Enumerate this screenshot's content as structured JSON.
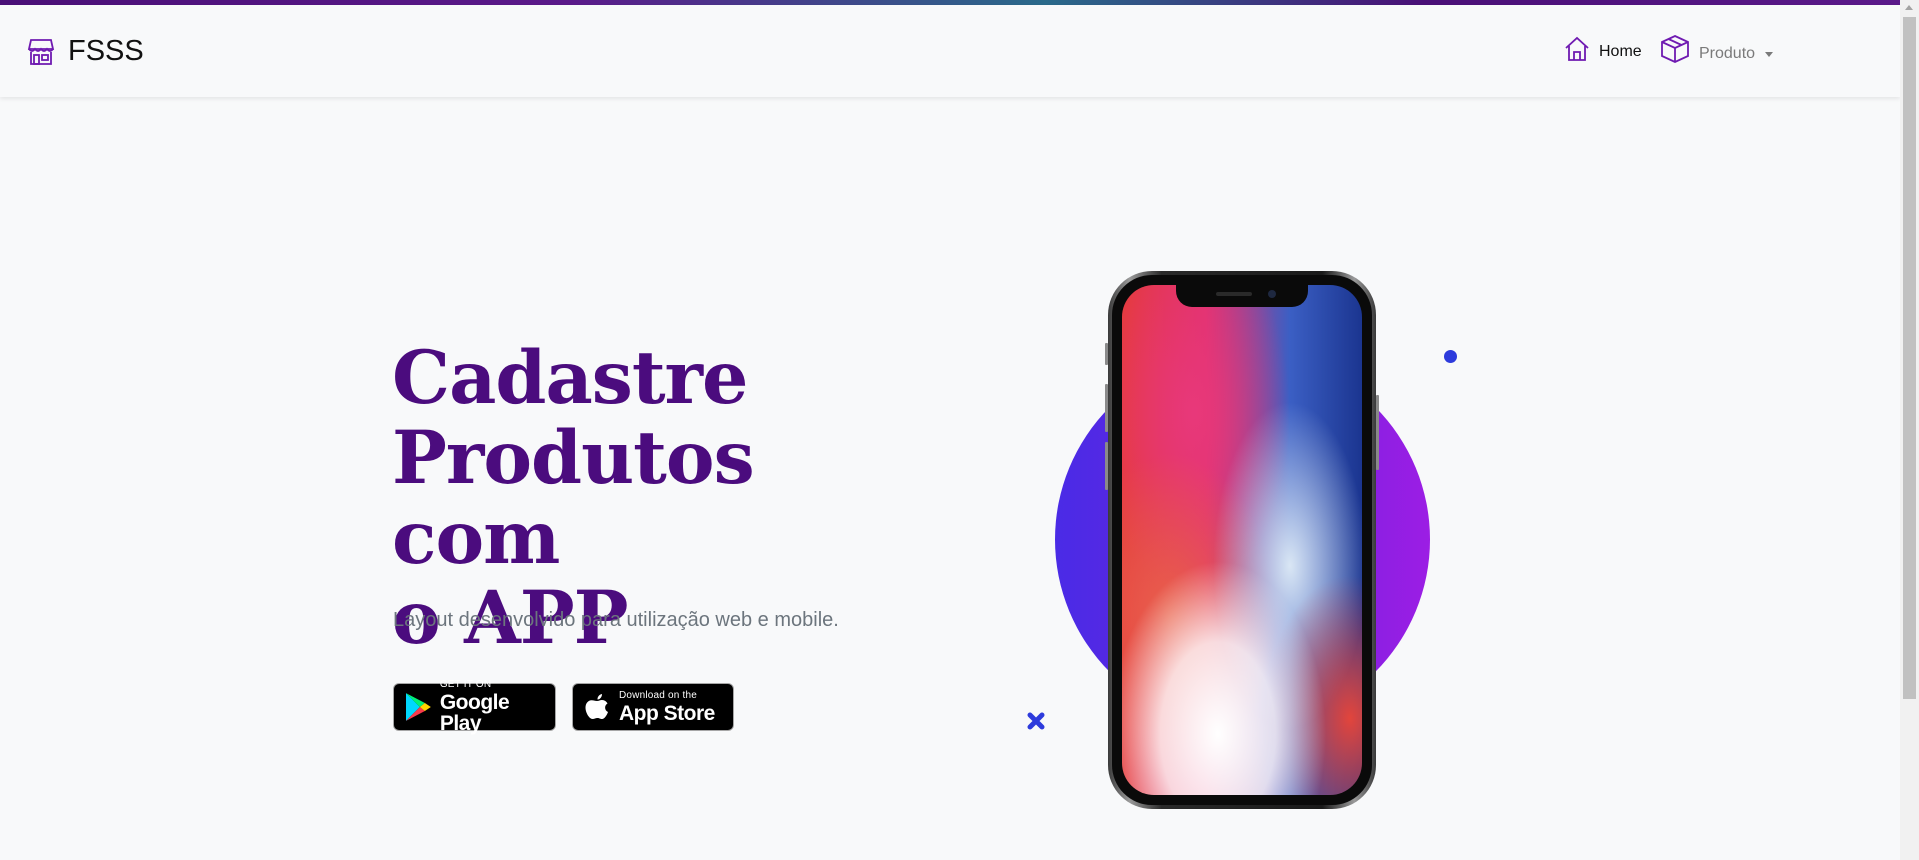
{
  "brand": {
    "name": "FSSS",
    "icon": "shop-icon"
  },
  "nav": {
    "home": {
      "label": "Home",
      "icon": "house-icon"
    },
    "produto": {
      "label": "Produto",
      "icon": "box-icon"
    }
  },
  "hero": {
    "title_line1": "Cadastre",
    "title_line2": "Produtos com",
    "title_line3": "o APP",
    "subtitle": "Layout desenvolvido para utilização web e mobile."
  },
  "store_buttons": {
    "google_play": {
      "small": "GET IT ON",
      "big": "Google Play"
    },
    "app_store": {
      "small": "Download on the",
      "big": "App Store"
    }
  },
  "colors": {
    "accent": "#4b0c7e",
    "icon_purple": "#6f1ab1",
    "circle_left": "#4a2be6",
    "circle_right": "#9c1ee4",
    "dot": "#2d3bdc"
  }
}
